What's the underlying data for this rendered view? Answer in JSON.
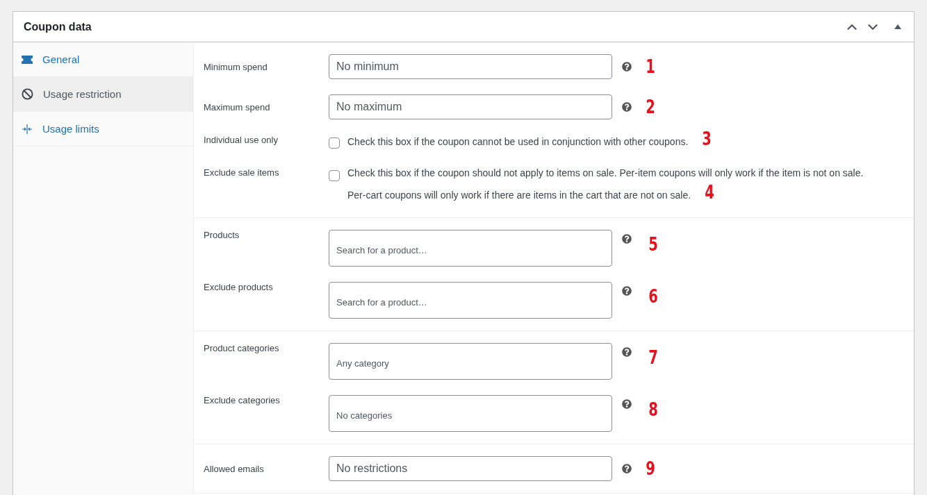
{
  "panel": {
    "title": "Coupon data"
  },
  "tabs": [
    {
      "label": "General",
      "selected": false,
      "kind": "ticket"
    },
    {
      "label": "Usage restriction",
      "selected": true,
      "kind": "ban"
    },
    {
      "label": "Usage limits",
      "selected": false,
      "kind": "limits"
    }
  ],
  "sections": [
    {
      "fields": [
        {
          "kind": "text",
          "label": "Minimum spend",
          "placeholder": "No minimum",
          "annotation": "1"
        },
        {
          "kind": "text",
          "label": "Maximum spend",
          "placeholder": "No maximum",
          "annotation": "2"
        },
        {
          "kind": "checkbox",
          "label": "Individual use only",
          "checked": false,
          "description": "Check this box if the coupon cannot be used in conjunction with other coupons.",
          "annotation": "3"
        },
        {
          "kind": "checkbox",
          "label": "Exclude sale items",
          "checked": false,
          "description": "Check this box if the coupon should not apply to items on sale. Per-item coupons will only work if the item is not on sale. Per-cart coupons will only work if there are items in the cart that are not on sale.",
          "annotation": "4"
        }
      ]
    },
    {
      "fields": [
        {
          "kind": "select",
          "label": "Products",
          "placeholder": "Search for a product…",
          "annotation": "5"
        },
        {
          "kind": "select",
          "label": "Exclude products",
          "placeholder": "Search for a product…",
          "annotation": "6"
        }
      ]
    },
    {
      "fields": [
        {
          "kind": "select",
          "label": "Product categories",
          "placeholder": "Any category",
          "annotation": "7"
        },
        {
          "kind": "select",
          "label": "Exclude categories",
          "placeholder": "No categories",
          "annotation": "8"
        }
      ]
    },
    {
      "fields": [
        {
          "kind": "text",
          "label": "Allowed emails",
          "placeholder": "No restrictions",
          "annotation": "9"
        }
      ]
    }
  ]
}
